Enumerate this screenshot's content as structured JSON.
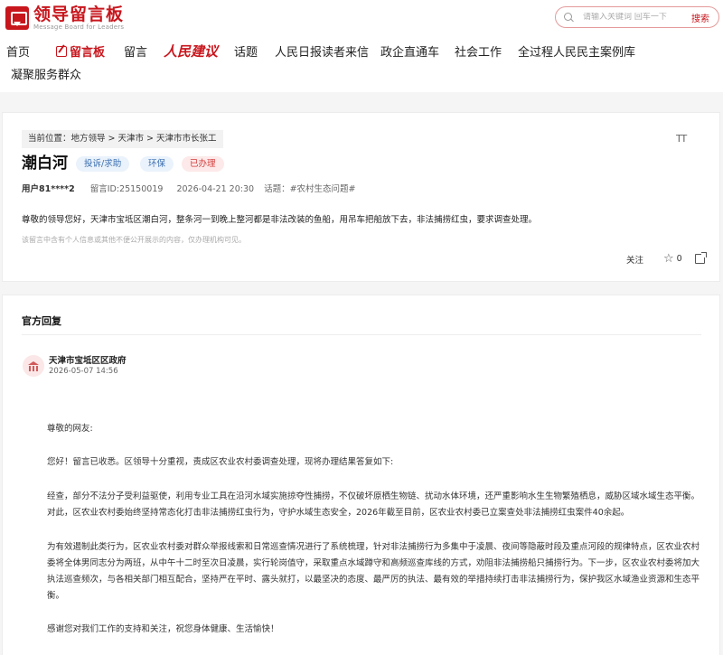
{
  "header": {
    "logo_text": "领导留言板",
    "logo_en": "Message Board for Leaders",
    "search_placeholder": "请输入关键词 回车一下",
    "search_button": "搜索"
  },
  "nav": {
    "items": [
      {
        "label": "首页"
      },
      {
        "label": "留言板"
      },
      {
        "label": "留言"
      },
      {
        "label": "人民建议"
      },
      {
        "label": "话题"
      },
      {
        "label": "人民日报读者来信"
      },
      {
        "label": "政企直通车"
      },
      {
        "label": "社会工作"
      },
      {
        "label": "全过程人民民主案例库"
      },
      {
        "label": "凝聚服务群众"
      }
    ]
  },
  "message": {
    "breadcrumb": "当前位置：地方领导 > 天津市 > 天津市市长张工",
    "font_toggle": "TT",
    "title": "潮白河",
    "tags": [
      "投诉/求助",
      "环保",
      "已办理"
    ],
    "user": "用户81****2",
    "message_id": "留言ID:25150019",
    "time": "2026-04-21 20:30",
    "topic": "话题：#农村生态问题#",
    "content": "尊敬的领导您好，天津市宝坻区潮白河，整条河一到晚上整河都是非法改装的鱼船，用吊车把船放下去，非法捕捞红虫，要求调查处理。",
    "note": "该留言中含有个人信息或其他不便公开展示的内容，仅办理机构可见。",
    "follow_label": "关注",
    "star_count": "0"
  },
  "reply": {
    "section_title": "官方回复",
    "org_name": "天津市宝坻区区政府",
    "time": "2026-05-07 14:56",
    "paragraphs": [
      "尊敬的网友:",
      "您好！留言已收悉。区领导十分重视，责成区农业农村委调查处理，现将办理结果答复如下:",
      "经查，部分不法分子受利益驱使，利用专业工具在沿河水域实施掠夺性捕捞，不仅破坏原栖生物链、扰动水体环境，还严重影响水生生物繁殖栖息，威胁区域水域生态平衡。对此，区农业农村委始终坚持常态化打击非法捕捞红虫行为，守护水域生态安全，2026年截至目前，区农业农村委已立案查处非法捕捞红虫案件40余起。",
      "为有效遏制此类行为，区农业农村委对群众举报线索和日常巡查情况进行了系统梳理，针对非法捕捞行为多集中于凌晨、夜间等隐蔽时段及重点河段的规律特点，区农业农村委将全体男同志分为两班，从中午十二时至次日凌晨，实行轮岗值守，采取重点水域蹲守和高频巡查库线的方式，劝阻非法捕捞船只捕捞行为。下一步，区农业农村委将加大执法巡查频次，与各相关部门相互配合，坚持严在平时、露头就打，以最坚决的态度、最严厉的执法、最有效的举措持续打击非法捕捞行为，保护我区水域渔业资源和生态平衡。",
      "感谢您对我们工作的支持和关注，祝您身体健康、生活愉快！"
    ]
  }
}
